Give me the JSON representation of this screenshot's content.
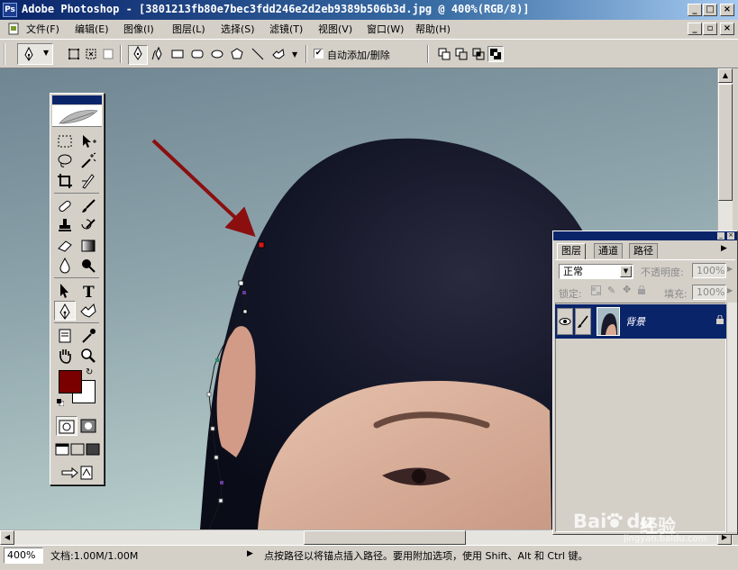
{
  "window": {
    "app_icon": "Ps",
    "title": "Adobe Photoshop - [3801213fb80e7bec3fdd246e2d2eb9389b506b3d.jpg @ 400%(RGB/8)]",
    "buttons": {
      "minimize": "_",
      "maximize": "□",
      "close": "×"
    }
  },
  "menu": {
    "items": [
      {
        "label": "文件(F)"
      },
      {
        "label": "编辑(E)"
      },
      {
        "label": "图像(I)"
      },
      {
        "label": "图层(L)"
      },
      {
        "label": "选择(S)"
      },
      {
        "label": "滤镜(T)"
      },
      {
        "label": "视图(V)"
      },
      {
        "label": "窗口(W)"
      },
      {
        "label": "帮助(H)"
      }
    ]
  },
  "options": {
    "auto_add_delete_label": "自动添加/删除",
    "auto_add_delete_checked": true
  },
  "toolbox": {
    "foreground_color": "#7a0000",
    "background_color": "#ffffff"
  },
  "layers_panel": {
    "tabs": [
      {
        "label": "图层"
      },
      {
        "label": "通道"
      },
      {
        "label": "路径"
      }
    ],
    "blend_mode": "正常",
    "opacity_label": "不透明度:",
    "opacity_value": "100%",
    "lock_label": "锁定:",
    "fill_label": "填充:",
    "fill_value": "100%",
    "layer_name": "背景"
  },
  "watermark": {
    "brand": "Bai",
    "brand2": "du",
    "product": "经验",
    "url": "jingyan.baidu.com"
  },
  "status": {
    "zoom": "400%",
    "doc_info": "文档:1.00M/1.00M",
    "hint": "点按路径以将锚点插入路径。要用附加选项，使用 Shift、Alt 和 Ctrl 键。"
  },
  "colors": {
    "title_bar": "#0a246a",
    "arrow": "#8b0f0f",
    "selection": "#0a246a"
  }
}
